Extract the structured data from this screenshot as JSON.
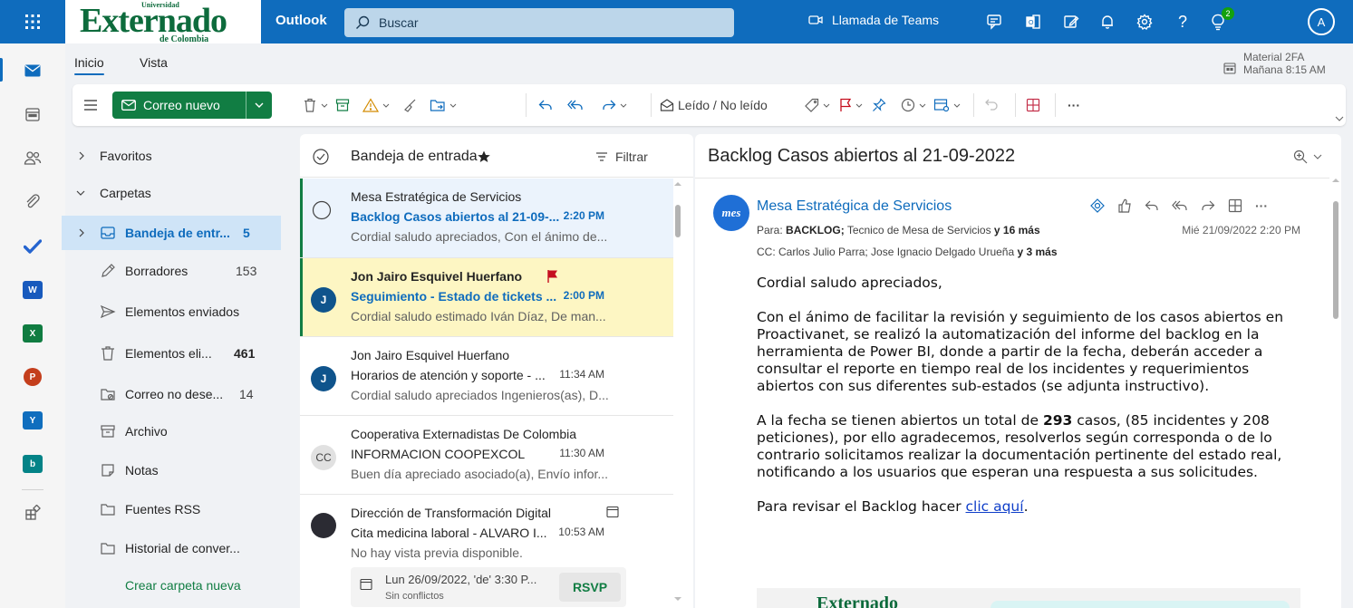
{
  "header": {
    "logo_university": "Universidad",
    "logo_main": "Externado",
    "logo_sub": "de Colombia",
    "app_name": "Outlook",
    "search_placeholder": "Buscar",
    "teams_call": "Llamada de Teams",
    "notification_badge": "2",
    "avatar_initial": "A",
    "brand_color": "#0f6cbd"
  },
  "tabs": {
    "home": "Inicio",
    "view": "Vista"
  },
  "reminder": {
    "title": "Material 2FA",
    "time": "Mañana 8:15 AM"
  },
  "ribbon": {
    "new_mail": "Correo nuevo",
    "read_unread": "Leído / No leído",
    "more": "···"
  },
  "folders": {
    "favorites": "Favoritos",
    "folders": "Carpetas",
    "items": [
      {
        "label": "Bandeja de entr...",
        "count": "5"
      },
      {
        "label": "Borradores",
        "count": "153"
      },
      {
        "label": "Elementos enviados",
        "count": ""
      },
      {
        "label": "Elementos eli...",
        "count": "461"
      },
      {
        "label": "Correo no dese...",
        "count": "14"
      },
      {
        "label": "Archivo",
        "count": ""
      },
      {
        "label": "Notas",
        "count": ""
      },
      {
        "label": "Fuentes RSS",
        "count": ""
      },
      {
        "label": "Historial de conver...",
        "count": ""
      }
    ],
    "create_new": "Crear carpeta nueva"
  },
  "message_list": {
    "title": "Bandeja de entrada",
    "filter": "Filtrar",
    "messages": [
      {
        "from": "Mesa Estratégica de Servicios",
        "subject": "Backlog Casos abiertos al 21-09-...",
        "time": "2:20 PM",
        "preview": "Cordial saludo apreciados, Con el ánimo de...",
        "avatar": ""
      },
      {
        "from": "Jon Jairo Esquivel Huerfano",
        "subject": "Seguimiento - Estado de tickets ...",
        "time": "2:00 PM",
        "preview": "Cordial saludo estimado Iván Díaz, De man...",
        "avatar": "J"
      },
      {
        "from": "Jon Jairo Esquivel Huerfano",
        "subject": "Horarios de atención y soporte - ...",
        "time": "11:34 AM",
        "preview": "Cordial saludo apreciados Ingenieros(as), D...",
        "avatar": "J"
      },
      {
        "from": "Cooperativa Externadistas De Colombia",
        "subject": "INFORMACION COOPEXCOL",
        "time": "11:30 AM",
        "preview": "Buen día apreciado asociado(a), Envío infor...",
        "avatar": "CC"
      },
      {
        "from": "Dirección de Transformación Digital",
        "subject": "Cita medicina laboral - ALVARO I...",
        "time": "10:53 AM",
        "preview": "No hay vista previa disponible.",
        "avatar": ""
      }
    ],
    "invite": {
      "when": "Lun 26/09/2022, 'de' 3:30 P...",
      "conflicts": "Sin conflictos",
      "rsvp": "RSVP"
    }
  },
  "reader": {
    "subject": "Backlog Casos abiertos al 21-09-2022",
    "logo_text": "mes",
    "sender": "Mesa Estratégica de Servicios",
    "to_label": "Para:",
    "to_main": "BACKLOG;",
    "to_rest": "Tecnico de Mesa de Servicios",
    "to_more": "y 16 más",
    "cc_label": "CC:",
    "cc_names": "Carlos Julio Parra;  Jose Ignacio Delgado Urueña",
    "cc_more": "y 3 más",
    "date": "Mié 21/09/2022 2:20 PM",
    "greeting": "Cordial saludo apreciados,",
    "para1": "Con el ánimo de facilitar la revisión y seguimiento de los casos abiertos en Proactivanet, se realizó la automatización del informe del backlog en la herramienta de Power BI, donde a partir de la fecha, deberán acceder a consultar el reporte en tiempo real de los incidentes y requerimientos abiertos con sus diferentes sub-estados (se adjunta instructivo).",
    "para2_a": "A la fecha se tienen abiertos un total de ",
    "para2_num": "293",
    "para2_b": " casos, (85 incidentes y 208 peticiones), por ello agradecemos, resolverlos según corresponda o de lo contrario solicitamos realizar la documentación pertinente del estado real, notificando a los usuarios que esperan una respuesta a sus solicitudes.",
    "para3_a": "Para revisar el Backlog hacer ",
    "para3_link": "clic aquí",
    "para3_b": "."
  }
}
